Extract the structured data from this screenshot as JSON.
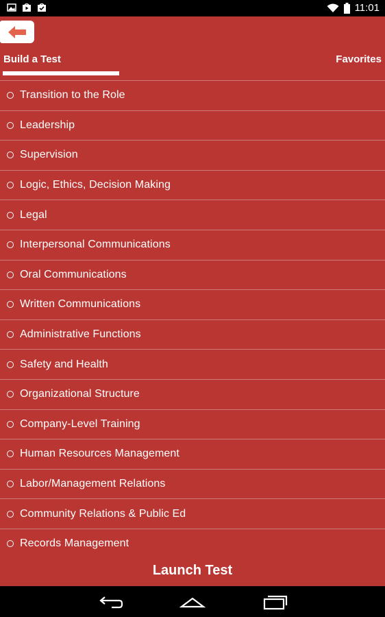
{
  "status_bar": {
    "time": "11:01",
    "icons": [
      "gallery-icon",
      "play-store-icon",
      "download-icon",
      "wifi-icon",
      "battery-icon"
    ]
  },
  "header": {
    "back_icon": "arrow-left-icon",
    "tabs": [
      {
        "label": "Build a Test",
        "selected": true
      },
      {
        "label": "Favorites",
        "selected": false
      }
    ]
  },
  "topics": [
    {
      "label": "Transition to the Role"
    },
    {
      "label": "Leadership"
    },
    {
      "label": "Supervision"
    },
    {
      "label": "Logic, Ethics, Decision Making"
    },
    {
      "label": "Legal"
    },
    {
      "label": "Interpersonal Communications"
    },
    {
      "label": "Oral Communications"
    },
    {
      "label": "Written Communications"
    },
    {
      "label": "Administrative Functions"
    },
    {
      "label": "Safety and Health"
    },
    {
      "label": "Organizational Structure"
    },
    {
      "label": "Company-Level Training"
    },
    {
      "label": "Human Resources Management"
    },
    {
      "label": "Labor/Management Relations"
    },
    {
      "label": "Community Relations & Public Ed"
    },
    {
      "label": "Records Management"
    }
  ],
  "launch_label": "Launch Test",
  "nav_icons": [
    "back-nav-icon",
    "home-nav-icon",
    "recents-nav-icon"
  ],
  "colors": {
    "background": "#b93632",
    "accent_arrow": "#e4634c"
  }
}
